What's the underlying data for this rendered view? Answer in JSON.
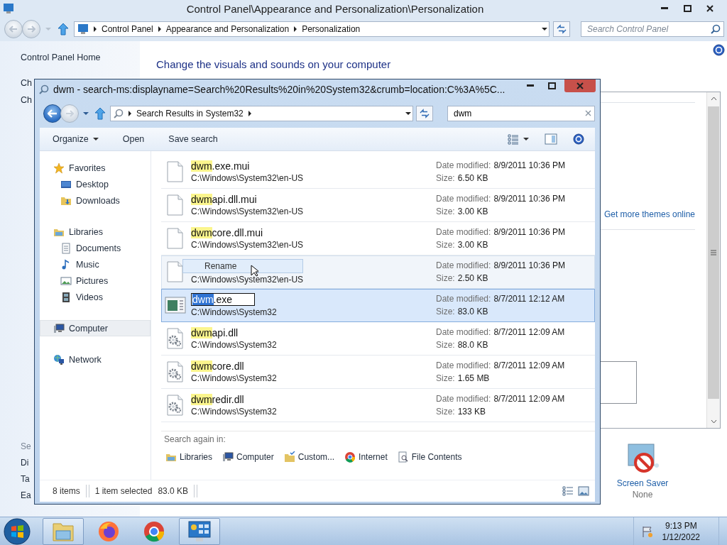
{
  "control_panel": {
    "title": "Control Panel\\Appearance and Personalization\\Personalization",
    "breadcrumb": [
      "Control Panel",
      "Appearance and Personalization",
      "Personalization"
    ],
    "search": {
      "placeholder": "Search Control Panel"
    },
    "sidebar": {
      "items": [
        "Control Panel Home",
        "Ch",
        "Ch"
      ],
      "see_also": {
        "heading": "Se",
        "items": [
          "Di",
          "Ta",
          "Ea"
        ]
      }
    },
    "heading": "Change the visuals and sounds on your computer",
    "themes_link": "Get more themes online",
    "screen_saver": {
      "label": "Screen Saver",
      "value": "None"
    }
  },
  "explorer": {
    "title": "dwm - search-ms:displayname=Search%20Results%20in%20System32&crumb=location:C%3A%5C...",
    "breadcrumb": [
      "Search Results in System32"
    ],
    "search": {
      "value": "dwm"
    },
    "toolbar": [
      {
        "label": "Organize",
        "kind": "menu"
      },
      {
        "label": "Open",
        "kind": "button"
      },
      {
        "label": "Save search",
        "kind": "button"
      }
    ],
    "nav": [
      {
        "label": "Favorites",
        "kind": "star",
        "selected": false,
        "children": [
          {
            "label": "Desktop",
            "kind": "desktop",
            "selected": false
          },
          {
            "label": "Downloads",
            "kind": "downloads",
            "selected": false
          }
        ]
      },
      {
        "label": "Libraries",
        "kind": "libraries",
        "selected": false,
        "children": [
          {
            "label": "Documents",
            "kind": "documents",
            "selected": false
          },
          {
            "label": "Music",
            "kind": "music",
            "selected": false
          },
          {
            "label": "Pictures",
            "kind": "pictures",
            "selected": false
          },
          {
            "label": "Videos",
            "kind": "videos",
            "selected": false
          }
        ]
      },
      {
        "label": "Computer",
        "kind": "computer",
        "selected": true
      },
      {
        "label": "Network",
        "kind": "network",
        "selected": false
      }
    ],
    "files": [
      {
        "kind": "blank",
        "match": "dwm",
        "rest": ".exe.mui",
        "path": "C:\\Windows\\System32\\en-US",
        "selected": false,
        "hovered": false,
        "editing": false,
        "date_label": "Date modified:",
        "date": "8/9/2011 10:36 PM",
        "size_label": "Size:",
        "size": "6.50 KB"
      },
      {
        "kind": "blank",
        "match": "dwm",
        "rest": "api.dll.mui",
        "path": "C:\\Windows\\System32\\en-US",
        "selected": false,
        "hovered": false,
        "editing": false,
        "date_label": "Date modified:",
        "date": "8/9/2011 10:36 PM",
        "size_label": "Size:",
        "size": "3.00 KB"
      },
      {
        "kind": "blank",
        "match": "dwm",
        "rest": "core.dll.mui",
        "path": "C:\\Windows\\System32\\en-US",
        "selected": false,
        "hovered": false,
        "editing": false,
        "date_label": "Date modified:",
        "date": "8/9/2011 10:36 PM",
        "size_label": "Size:",
        "size": "3.00 KB"
      },
      {
        "kind": "blank",
        "drag_label": "Rename",
        "path": "C:\\Windows\\System32\\en-US",
        "selected": false,
        "hovered": true,
        "date_label": "Date modified:",
        "date": "8/9/2011 10:36 PM",
        "size_label": "Size:",
        "size": "2.50 KB"
      },
      {
        "kind": "exe",
        "match": "dwm",
        "rest": ".exe",
        "path": "C:\\Windows\\System32",
        "selected": true,
        "hovered": false,
        "editing": true,
        "date_label": "Date modified:",
        "date": "8/7/2011 12:12 AM",
        "size_label": "Size:",
        "size": "83.0 KB"
      },
      {
        "kind": "dll",
        "match": "dwm",
        "rest": "api.dll",
        "path": "C:\\Windows\\System32",
        "selected": false,
        "hovered": false,
        "editing": false,
        "date_label": "Date modified:",
        "date": "8/7/2011 12:09 AM",
        "size_label": "Size:",
        "size": "88.0 KB"
      },
      {
        "kind": "dll",
        "match": "dwm",
        "rest": "core.dll",
        "path": "C:\\Windows\\System32",
        "selected": false,
        "hovered": false,
        "editing": false,
        "date_label": "Date modified:",
        "date": "8/7/2011 12:09 AM",
        "size_label": "Size:",
        "size": "1.65 MB"
      },
      {
        "kind": "dll",
        "match": "dwm",
        "rest": "redir.dll",
        "path": "C:\\Windows\\System32",
        "selected": false,
        "hovered": false,
        "editing": false,
        "date_label": "Date modified:",
        "date": "8/7/2011 12:09 AM",
        "size_label": "Size:",
        "size": "133 KB"
      }
    ],
    "search_again": {
      "label": "Search again in:",
      "items": [
        {
          "label": "Libraries",
          "kind": "libraries"
        },
        {
          "label": "Computer",
          "kind": "computer"
        },
        {
          "label": "Custom...",
          "kind": "custom"
        },
        {
          "label": "Internet",
          "kind": "internet"
        },
        {
          "label": "File Contents",
          "kind": "file-contents"
        }
      ]
    },
    "status": {
      "count": "8 items",
      "selection": "1 item selected",
      "size": "83.0 KB"
    }
  },
  "taskbar": {
    "apps": [
      {
        "kind": "explorer",
        "open": true
      },
      {
        "kind": "firefox",
        "open": false
      },
      {
        "kind": "chrome",
        "open": false
      },
      {
        "kind": "control-panel",
        "open": true
      }
    ],
    "clock": {
      "time": "9:13 PM",
      "date": "1/12/2022"
    }
  }
}
